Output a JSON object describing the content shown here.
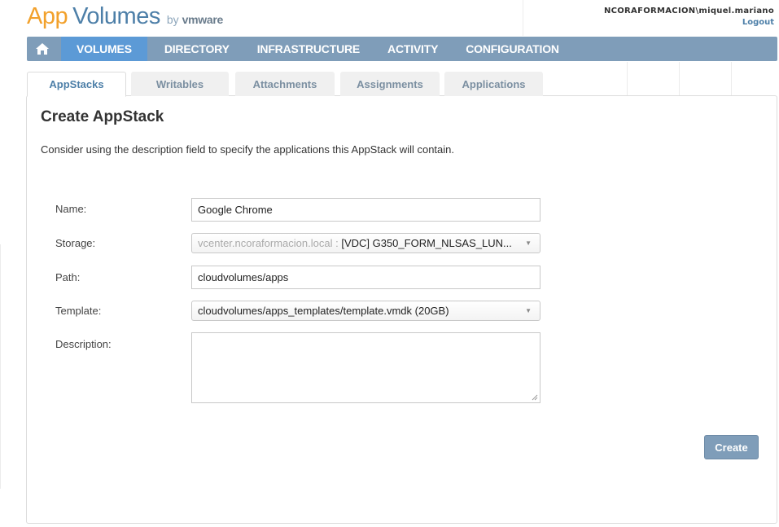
{
  "logo": {
    "app": "App",
    "volumes": "Volumes",
    "by": "by",
    "vmware": "vmware"
  },
  "user": {
    "name": "NCORAFORMACION\\miquel.mariano",
    "logout": "Logout"
  },
  "nav": {
    "home_icon": "home-icon",
    "items": [
      "VOLUMES",
      "DIRECTORY",
      "INFRASTRUCTURE",
      "ACTIVITY",
      "CONFIGURATION"
    ],
    "active": "VOLUMES"
  },
  "tabs": {
    "items": [
      "AppStacks",
      "Writables",
      "Attachments",
      "Assignments",
      "Applications"
    ],
    "active": "AppStacks"
  },
  "page": {
    "title": "Create AppStack",
    "description": "Consider using the description field to specify the applications this AppStack will contain."
  },
  "form": {
    "name_label": "Name:",
    "name_value": "Google Chrome",
    "storage_label": "Storage:",
    "storage_prefix": "vcenter.ncoraformacion.local :",
    "storage_value": "[VDC] G350_FORM_NLSAS_LUN...",
    "path_label": "Path:",
    "path_value": "cloudvolumes/apps",
    "template_label": "Template:",
    "template_value": "cloudvolumes/apps_templates/template.vmdk (20GB)",
    "description_label": "Description:",
    "description_value": ""
  },
  "actions": {
    "create_label": "Create"
  },
  "colors": {
    "navbar": "#7f9db9",
    "nav_active": "#5c9ad6",
    "logo_orange": "#f2a12c",
    "logo_blue": "#4d7fa8",
    "button": "#7f9db9"
  }
}
